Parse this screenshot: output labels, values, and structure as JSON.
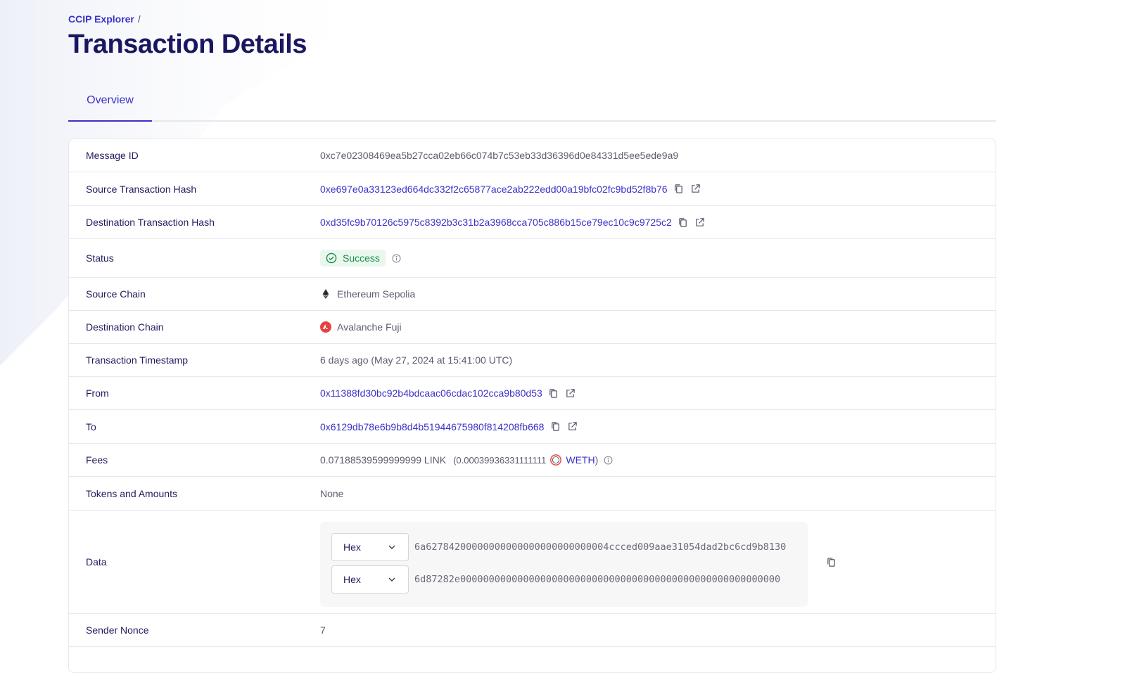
{
  "breadcrumb": {
    "root": "CCIP Explorer",
    "separator": "/"
  },
  "page_title": "Transaction Details",
  "tabs": [
    {
      "label": "Overview",
      "active": true
    }
  ],
  "rows": {
    "message_id": {
      "label": "Message ID",
      "value": "0xc7e02308469ea5b27cca02eb66c074b7c53eb33d36396d0e84331d5ee5ede9a9"
    },
    "source_tx": {
      "label": "Source Transaction Hash",
      "value": "0xe697e0a33123ed664dc332f2c65877ace2ab222edd00a19bfc02fc9bd52f8b76"
    },
    "dest_tx": {
      "label": "Destination Transaction Hash",
      "value": "0xd35fc9b70126c5975c8392b3c31b2a3968cca705c886b15ce79ec10c9c9725c2"
    },
    "status": {
      "label": "Status",
      "value": "Success"
    },
    "source_chain": {
      "label": "Source Chain",
      "value": "Ethereum Sepolia"
    },
    "dest_chain": {
      "label": "Destination Chain",
      "value": "Avalanche Fuji"
    },
    "timestamp": {
      "label": "Transaction Timestamp",
      "value": "6 days ago (May 27, 2024 at 15:41:00 UTC)"
    },
    "from": {
      "label": "From",
      "value": "0x11388fd30bc92b4bdcaac06cdac102cca9b80d53"
    },
    "to": {
      "label": "To",
      "value": "0x6129db78e6b9b8d4b51944675980f814208fb668"
    },
    "fees": {
      "label": "Fees",
      "link_amount": "0.07188539599999999 LINK",
      "paren_open": "(0.00039936331111111",
      "token": "WETH",
      "paren_close": ")"
    },
    "tokens": {
      "label": "Tokens and Amounts",
      "value": "None"
    },
    "data": {
      "label": "Data",
      "lines": [
        {
          "format": "Hex",
          "value": "6a62784200000000000000000000000004ccced009aae31054dad2bc6cd9b8130"
        },
        {
          "format": "Hex",
          "value": "6d87282e00000000000000000000000000000000000000000000000000000000"
        }
      ]
    },
    "sender_nonce": {
      "label": "Sender Nonce",
      "value": "7"
    }
  },
  "colors": {
    "accent": "#3c30c8",
    "title": "#1a1660",
    "success_bg": "#eaf7ee",
    "success_text": "#1a8c4a",
    "avalanche": "#e84142"
  }
}
